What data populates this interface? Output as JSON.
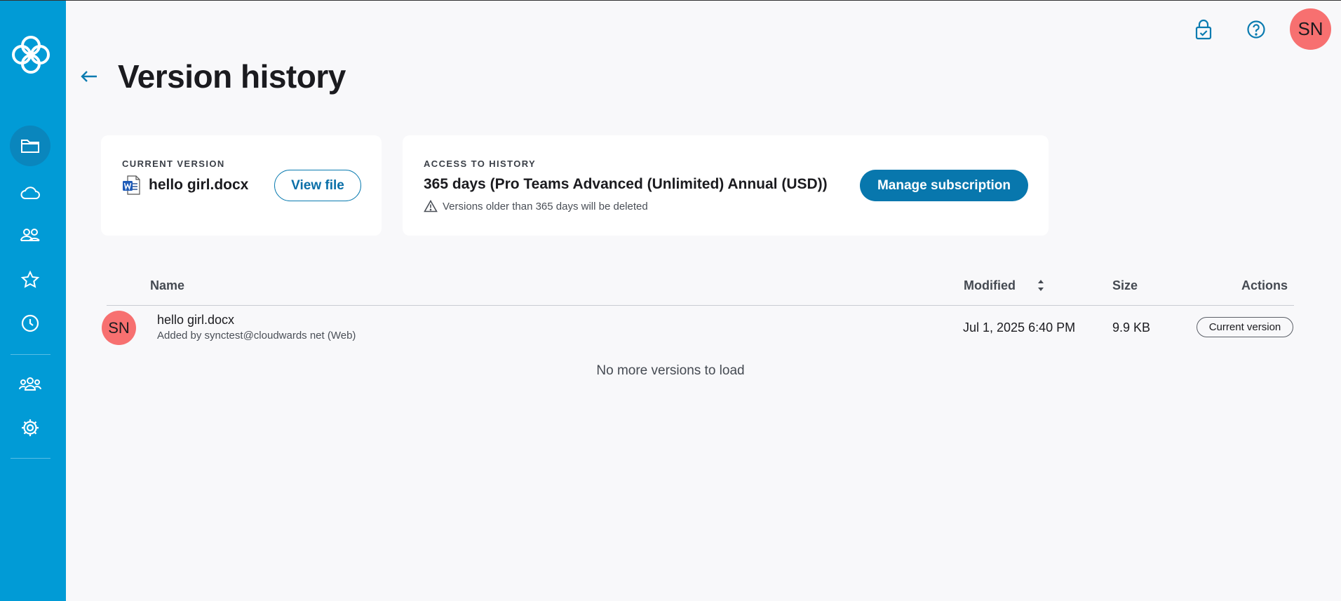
{
  "header": {
    "title": "Version history",
    "avatar_initials": "SN"
  },
  "sidebar": {
    "items": [
      {
        "name": "files",
        "icon": "folder-icon",
        "active": true
      },
      {
        "name": "cloud",
        "icon": "cloud-icon",
        "active": false
      },
      {
        "name": "shared",
        "icon": "people-icon",
        "active": false
      },
      {
        "name": "favorites",
        "icon": "star-icon",
        "active": false
      },
      {
        "name": "recent",
        "icon": "clock-icon",
        "active": false
      },
      {
        "name": "team",
        "icon": "team-icon",
        "active": false
      },
      {
        "name": "settings",
        "icon": "gear-icon",
        "active": false
      }
    ]
  },
  "current_version": {
    "label": "CURRENT VERSION",
    "file_name": "hello girl.docx",
    "file_icon": "word-doc-icon",
    "view_button": "View file"
  },
  "history_access": {
    "label": "ACCESS TO HISTORY",
    "plan": "365 days (Pro Teams Advanced (Unlimited) Annual (USD))",
    "warning": "Versions older than 365 days will be deleted",
    "manage_button": "Manage subscription"
  },
  "table": {
    "columns": {
      "name": "Name",
      "modified": "Modified",
      "size": "Size",
      "actions": "Actions"
    },
    "rows": [
      {
        "avatar": "SN",
        "name": "hello girl.docx",
        "added_by": "Added by synctest@cloudwards net (Web)",
        "modified": "Jul 1, 2025 6:40 PM",
        "size": "9.9 KB",
        "action_badge": "Current version"
      }
    ],
    "footer": "No more versions to load"
  },
  "colors": {
    "sidebar": "#019bd6",
    "primary": "#0877ad",
    "avatar": "#f77070"
  }
}
